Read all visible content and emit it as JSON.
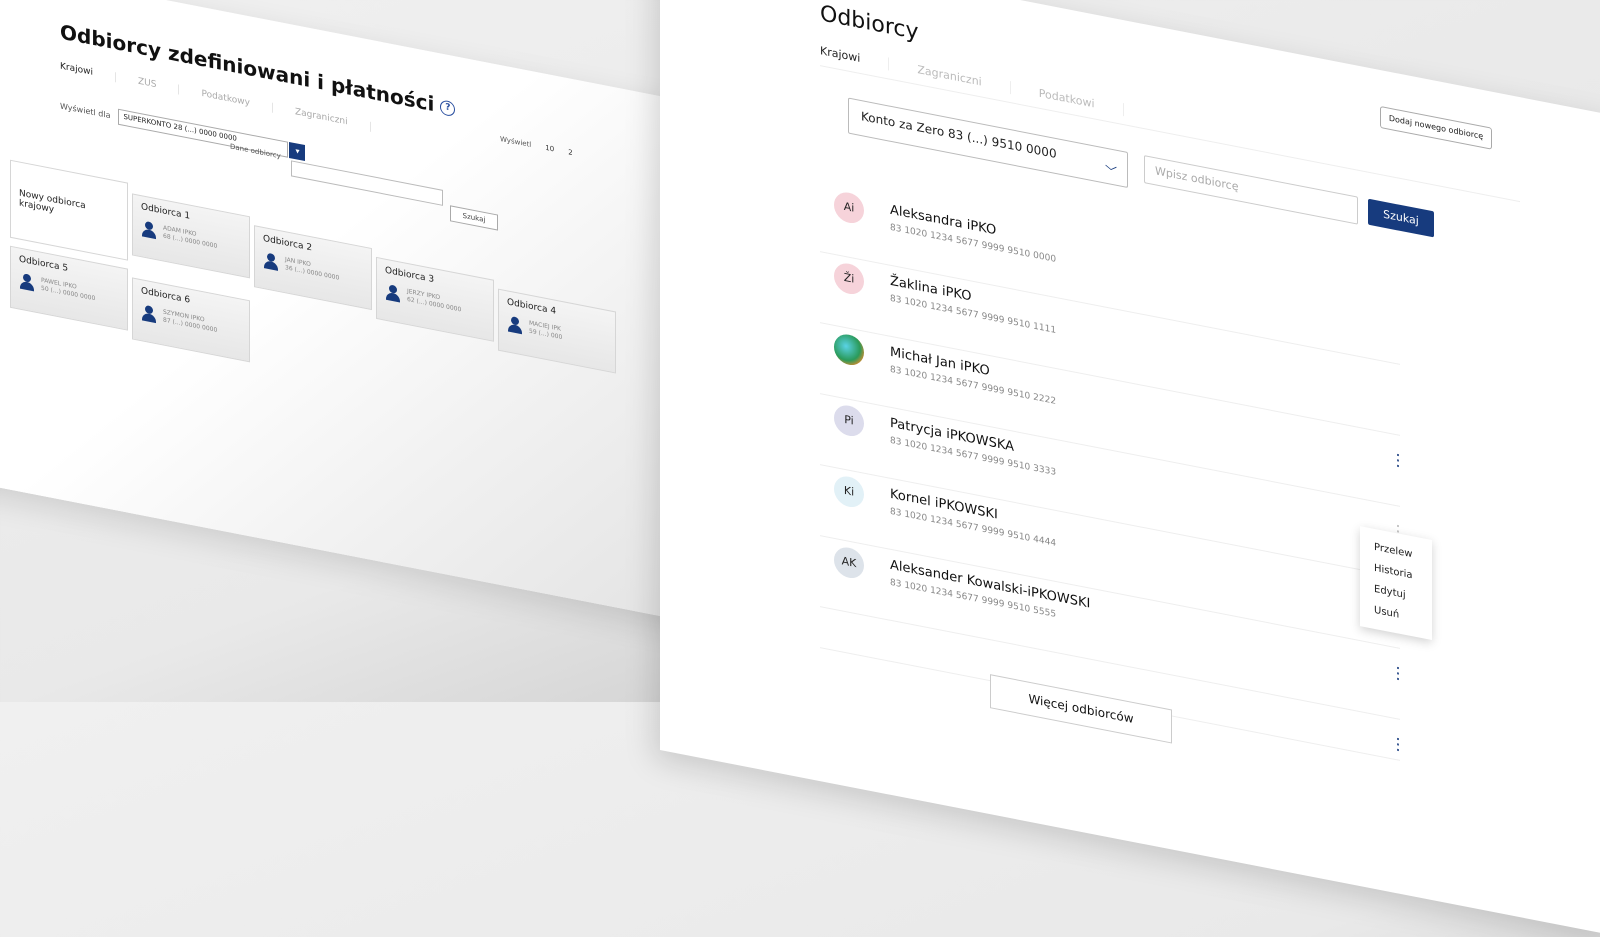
{
  "old_panel": {
    "title": "Odbiorcy zdefiniowani i płatności",
    "help": "?",
    "tabs": [
      "Krajowi",
      "ZUS",
      "Podatkowy",
      "Zagraniczni"
    ],
    "filter_label": "Wyświetl dla",
    "account_select": "SUPERKONTO 28 (...) 0000 0000",
    "search_label": "Dane odbiorcy",
    "search_button": "Szukaj",
    "show_label": "Wyświetl",
    "show_values": [
      "10",
      "2"
    ],
    "new_card": "Nowy odbiorca krajowy",
    "cards": [
      {
        "title": "Odbiorca 1",
        "name": "ADAM IPKO",
        "acc": "68 (...) 0000 0000"
      },
      {
        "title": "Odbiorca 2",
        "name": "JAN IPKO",
        "acc": "36 (...) 0000 0000"
      },
      {
        "title": "Odbiorca 3",
        "name": "JERZY IPKO",
        "acc": "62 (...) 0000 0000"
      },
      {
        "title": "Odbiorca 4",
        "name": "MACIEJ IPK",
        "acc": "59 (...) 000"
      },
      {
        "title": "Odbiorca 5",
        "name": "PAWEL IPKO",
        "acc": "50 (...) 0000 0000"
      },
      {
        "title": "Odbiorca 6",
        "name": "SZYMON IPKO",
        "acc": "87 (...) 0000 0000"
      }
    ]
  },
  "new_panel": {
    "title": "Odbiorcy",
    "tabs": [
      "Krajowi",
      "Zagraniczni",
      "Podatkowi"
    ],
    "account_select": "Konto za Zero 83 (...) 9510 0000",
    "recipient_placeholder": "Wpisz odbiorcę",
    "search_button": "Szukaj",
    "add_button": "Dodaj nowego odbiorcę",
    "recipients": [
      {
        "initials": "Ai",
        "name": "Aleksandra iPKO",
        "account": "83 1020 1234 5677 9999 9510 0000",
        "avatar_color": "#f6d3da"
      },
      {
        "initials": "Ži",
        "name": "Žaklina iPKO",
        "account": "83 1020 1234 5677 9999 9510 1111",
        "avatar_color": "#f6d3da"
      },
      {
        "initials": "",
        "name": "Michał Jan iPKO",
        "account": "83 1020 1234 5677 9999 9510 2222",
        "avatar_color": "photo"
      },
      {
        "initials": "Pi",
        "name": "Patrycja iPKOWSKA",
        "account": "83 1020 1234 5677 9999 9510 3333",
        "avatar_color": "#dcdcec"
      },
      {
        "initials": "Ki",
        "name": "Kornel iPKOWSKI",
        "account": "83 1020 1234 5677 9999 9510 4444",
        "avatar_color": "#e2f1f7"
      },
      {
        "initials": "AK",
        "name": "Aleksander Kowalski-iPKOWSKI",
        "account": "83 1020 1234 5677 9999 9510 5555",
        "avatar_color": "#dde3ea"
      }
    ],
    "context_menu": [
      "Przelew",
      "Historia",
      "Edytuj",
      "Usuń"
    ],
    "more_button": "Więcej odbiorców"
  },
  "colors": {
    "accent": "#173b7e"
  }
}
